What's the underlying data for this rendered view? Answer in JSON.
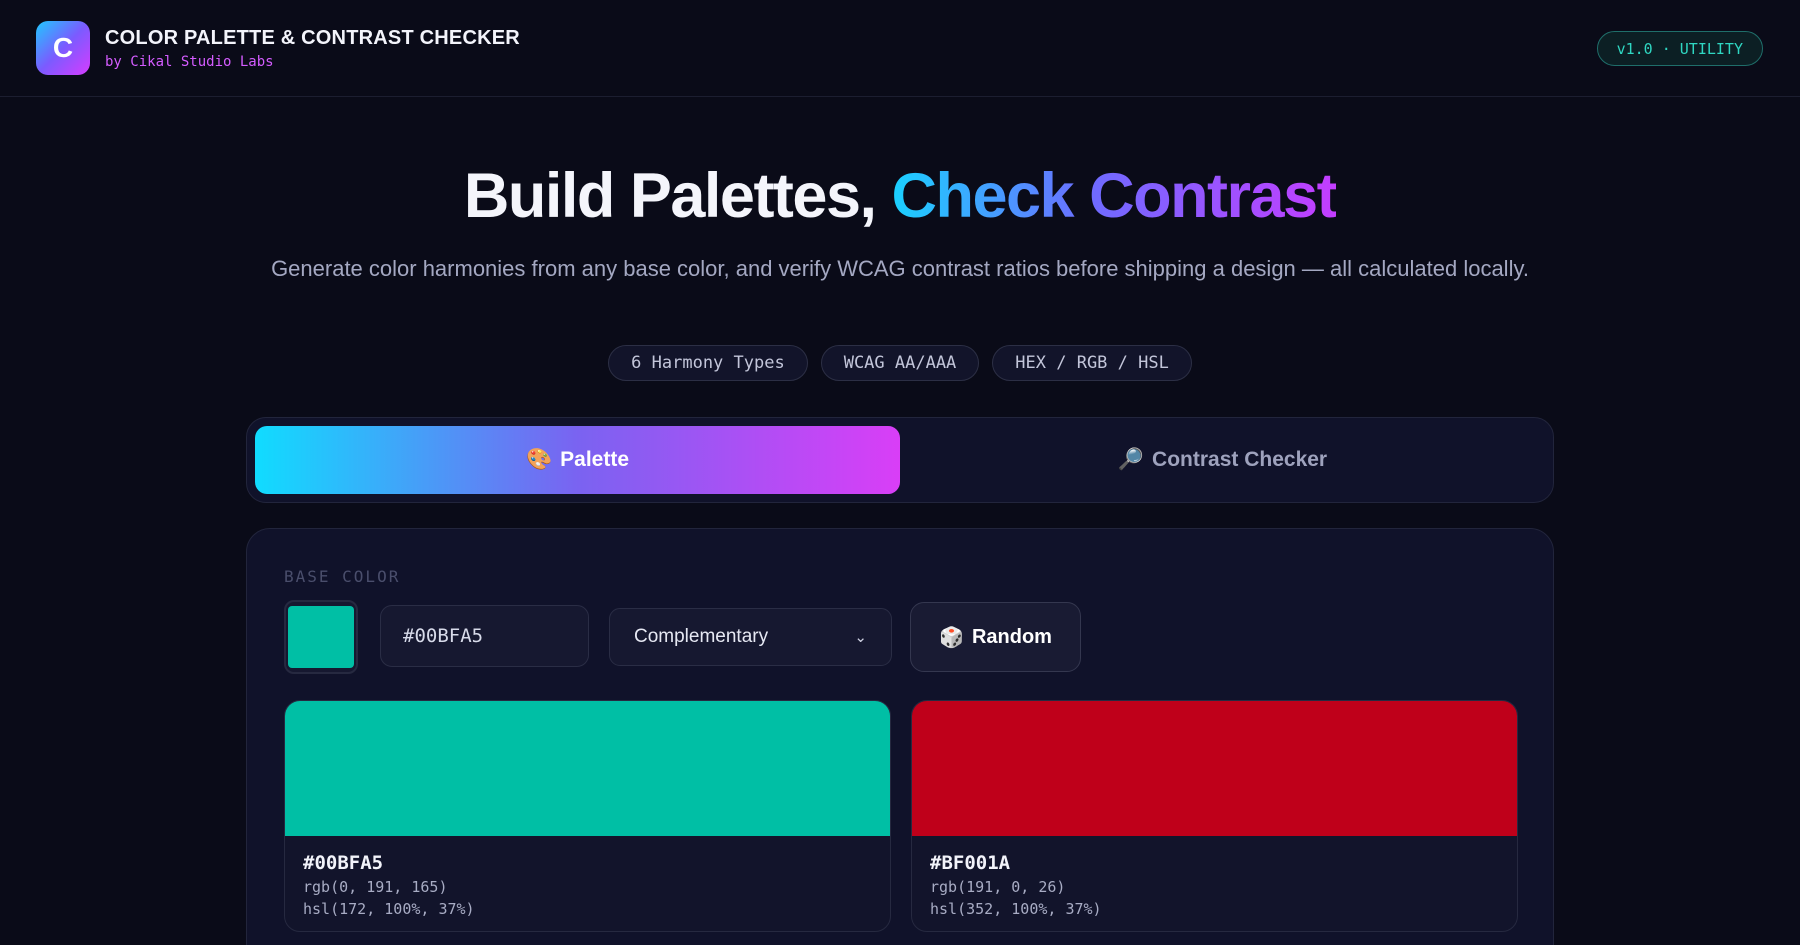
{
  "header": {
    "logo_letter": "C",
    "title": "COLOR PALETTE & CONTRAST CHECKER",
    "subtitle": "by Cikal Studio Labs",
    "version_badge": "v1.0 · UTILITY"
  },
  "hero": {
    "title_part1": "Build Palettes,",
    "title_part2": "Check Contrast",
    "subtitle": "Generate color harmonies from any base color, and verify WCAG contrast ratios before shipping a design — all calculated locally.",
    "chips": [
      "6 Harmony Types",
      "WCAG AA/AAA",
      "HEX / RGB / HSL"
    ]
  },
  "tabs": [
    {
      "icon": "🎨",
      "label": "Palette",
      "active": true
    },
    {
      "icon": "🔎",
      "label": "Contrast Checker",
      "active": false
    }
  ],
  "palette_panel": {
    "section_label": "BASE COLOR",
    "base_color": "#00BFA5",
    "hex_value": "#00BFA5",
    "harmony_selected": "Complementary",
    "random_icon": "🎲",
    "random_label": "Random",
    "colors": [
      {
        "hex": "#00BFA5",
        "rgb": "rgb(0, 191, 165)",
        "hsl": "hsl(172, 100%, 37%)"
      },
      {
        "hex": "#BF001A",
        "rgb": "rgb(191, 0, 26)",
        "hsl": "hsl(352, 100%, 37%)"
      }
    ]
  },
  "theme": {
    "background": "#0a0b18",
    "accent_cyan": "#1ad1ff",
    "accent_purple": "#c43dff",
    "badge_teal": "#2fd7c2"
  }
}
